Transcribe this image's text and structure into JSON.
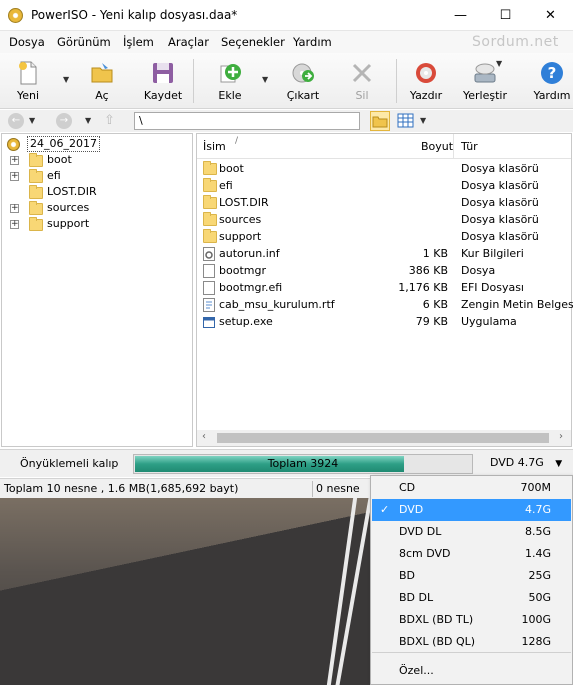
{
  "window": {
    "title": "PowerISO - Yeni kalıp dosyası.daa*",
    "minimize": "—",
    "maximize": "☐",
    "close": "✕"
  },
  "menu": {
    "items": [
      "Dosya",
      "Görünüm",
      "İşlem",
      "Araçlar",
      "Seçenekler",
      "Yardım"
    ],
    "brand": "Sordum.net"
  },
  "toolbar": {
    "new": "Yeni",
    "open": "Aç",
    "save": "Kaydet",
    "add": "Ekle",
    "extract": "Çıkart",
    "delete": "Sil",
    "burn": "Yazdır",
    "mount": "Yerleştir",
    "help": "Yardım"
  },
  "address": {
    "path": "\\"
  },
  "tree": {
    "root": "24_06_2017",
    "items": [
      "boot",
      "efi",
      "LOST.DIR",
      "sources",
      "support"
    ]
  },
  "files": {
    "headers": {
      "name": "İsim",
      "sort_mark": "/",
      "size": "Boyut",
      "type": "Tür"
    },
    "rows": [
      {
        "name": "boot",
        "size": "",
        "type": "Dosya klasörü",
        "icon": "folder-icon"
      },
      {
        "name": "efi",
        "size": "",
        "type": "Dosya klasörü",
        "icon": "folder-icon"
      },
      {
        "name": "LOST.DIR",
        "size": "",
        "type": "Dosya klasörü",
        "icon": "folder-icon"
      },
      {
        "name": "sources",
        "size": "",
        "type": "Dosya klasörü",
        "icon": "folder-icon"
      },
      {
        "name": "support",
        "size": "",
        "type": "Dosya klasörü",
        "icon": "folder-icon"
      },
      {
        "name": "autorun.inf",
        "size": "1 KB",
        "type": "Kur Bilgileri",
        "icon": "settings-file-icon"
      },
      {
        "name": "bootmgr",
        "size": "386 KB",
        "type": "Dosya",
        "icon": "file-icon"
      },
      {
        "name": "bootmgr.efi",
        "size": "1,176 KB",
        "type": "EFI Dosyası",
        "icon": "file-icon"
      },
      {
        "name": "cab_msu_kurulum.rtf",
        "size": "6 KB",
        "type": "Zengin Metin Belgesi",
        "icon": "document-icon"
      },
      {
        "name": "setup.exe",
        "size": "79 KB",
        "type": "Uygulama",
        "icon": "application-icon"
      }
    ]
  },
  "capacity": {
    "boot_label": "Önyüklemeli kalıp",
    "progress_text": "Toplam 3924",
    "progress_fraction": 0.8,
    "media_selected": "DVD 4.7G"
  },
  "status": {
    "left": "Toplam 10 nesne , 1.6 MB(1,685,692 bayt)",
    "right": "0 nesne"
  },
  "dropdown": {
    "items": [
      {
        "label": "CD",
        "size": "700M",
        "selected": false
      },
      {
        "label": "DVD",
        "size": "4.7G",
        "selected": true
      },
      {
        "label": "DVD DL",
        "size": "8.5G",
        "selected": false
      },
      {
        "label": "8cm DVD",
        "size": "1.4G",
        "selected": false
      },
      {
        "label": "BD",
        "size": "25G",
        "selected": false
      },
      {
        "label": "BD DL",
        "size": "50G",
        "selected": false
      },
      {
        "label": "BDXL (BD TL)",
        "size": "100G",
        "selected": false
      },
      {
        "label": "BDXL (BD QL)",
        "size": "128G",
        "selected": false
      }
    ],
    "custom": "Özel..."
  },
  "colors": {
    "selection": "#3399ff",
    "progress": "#2e9f86"
  }
}
